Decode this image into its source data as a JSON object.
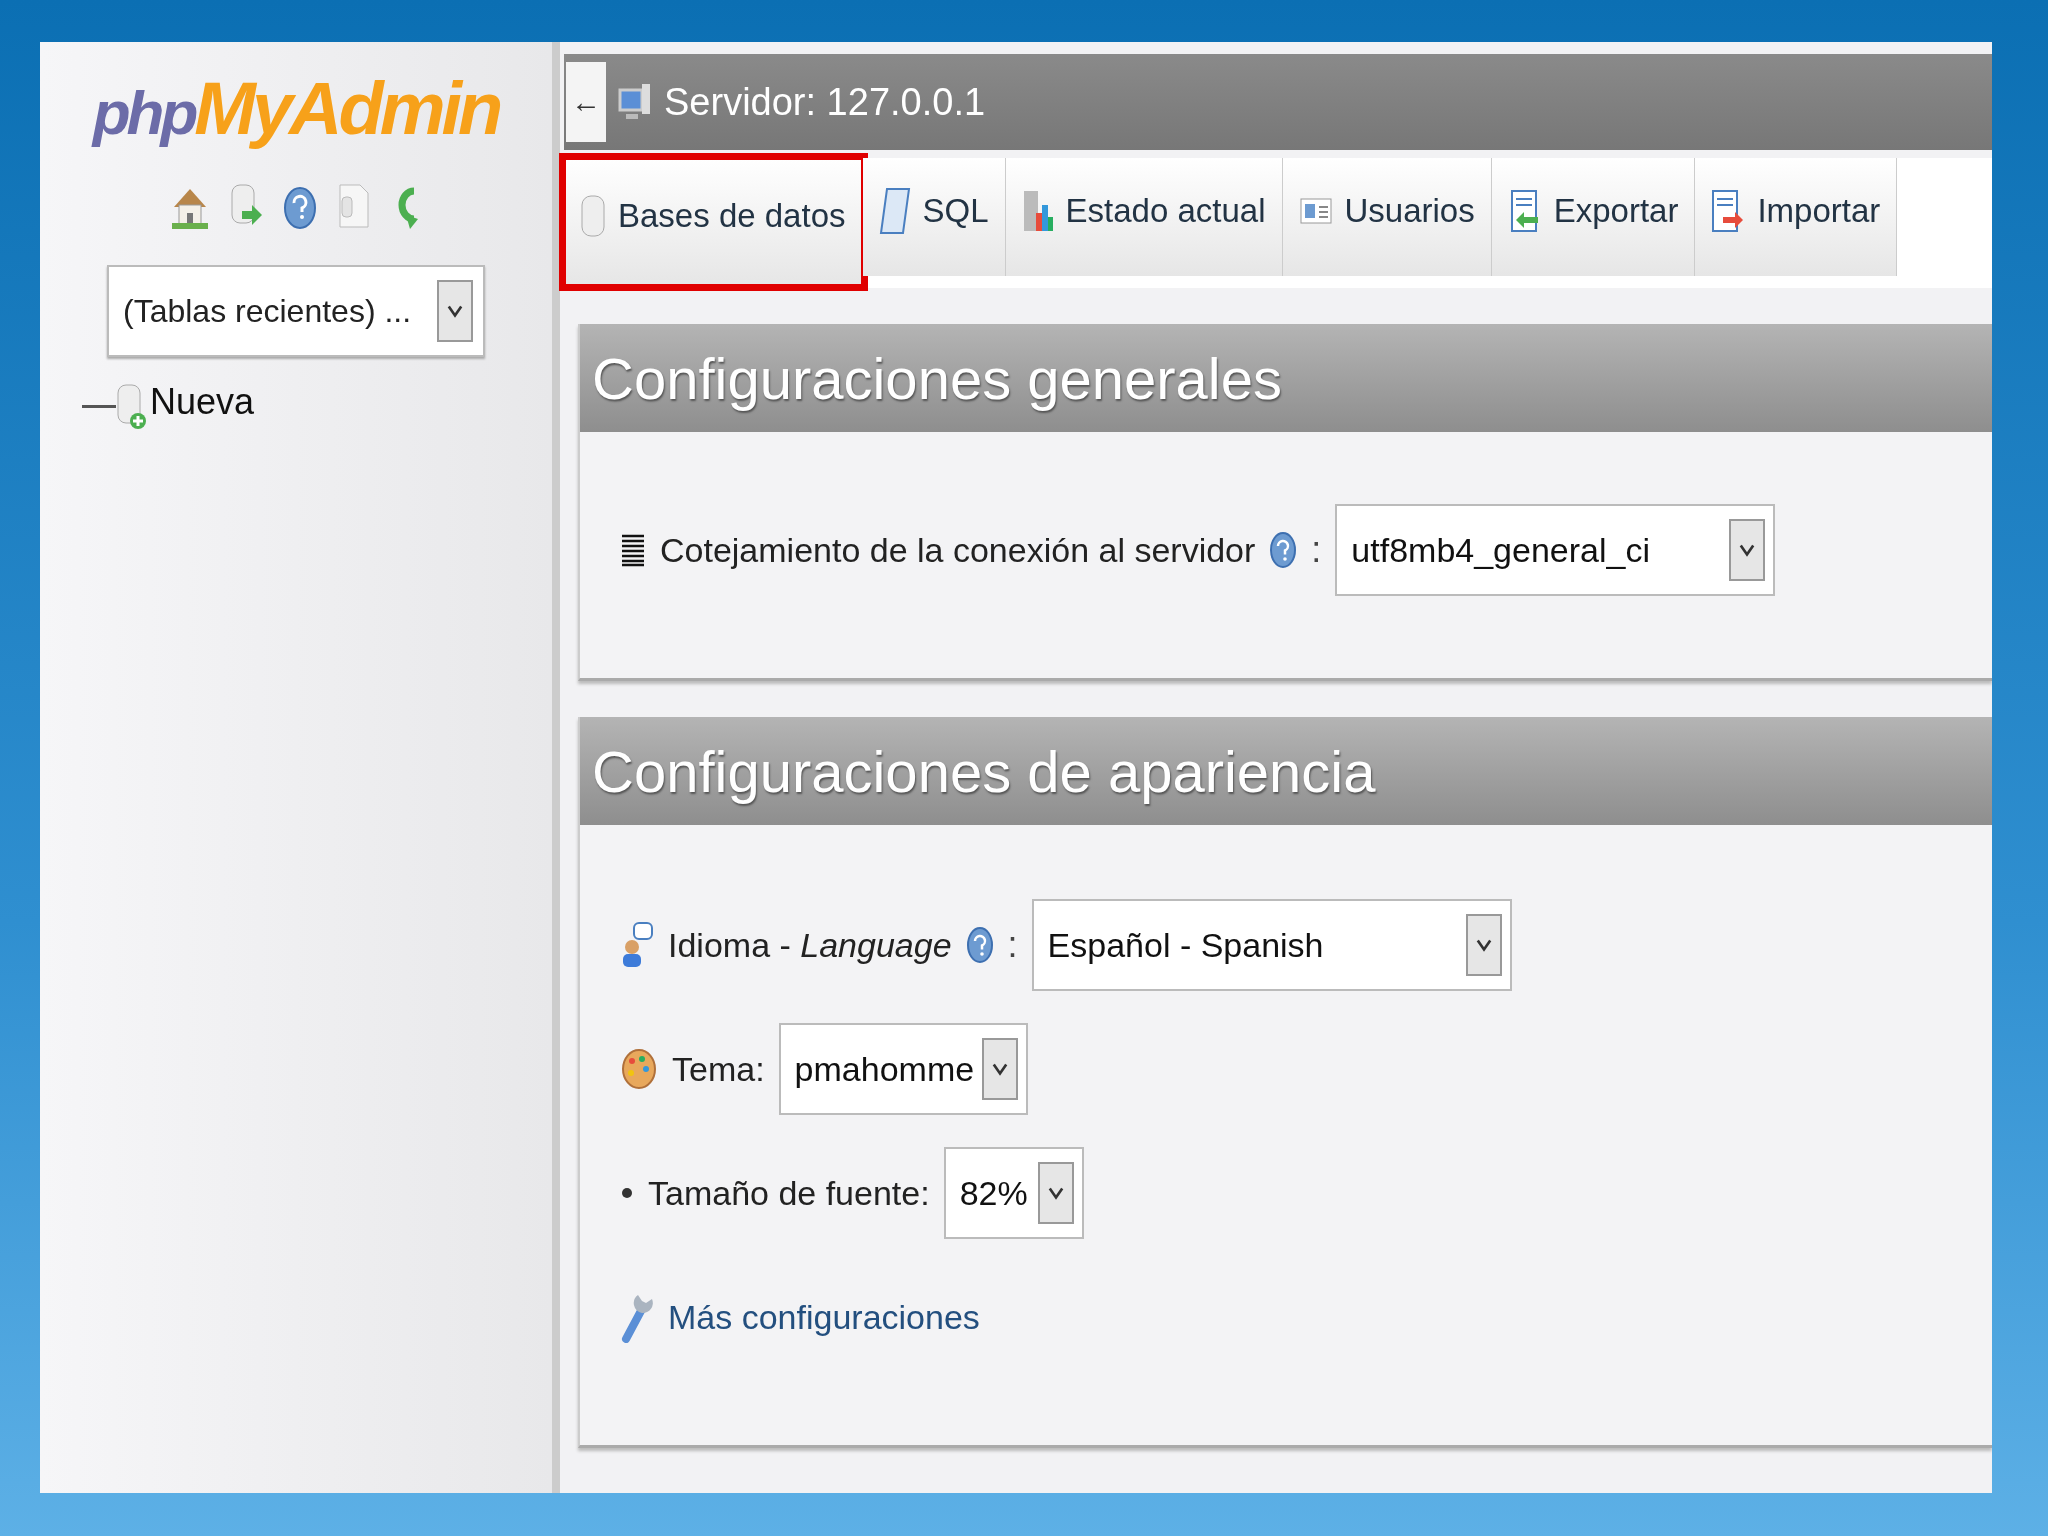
{
  "logo": {
    "part_1": "php",
    "part_2": "MyAdmin"
  },
  "sidebar": {
    "recent_tables": "(Tablas recientes) ...",
    "tree": [
      {
        "label": "Nueva"
      }
    ]
  },
  "breadcrumb": {
    "back": "←",
    "server": "Servidor: 127.0.0.1"
  },
  "tabs": [
    {
      "label": "Bases de datos",
      "highlighted": true
    },
    {
      "label": "SQL",
      "highlighted": false
    },
    {
      "label": "Estado actual",
      "highlighted": false
    },
    {
      "label": "Usuarios",
      "highlighted": false
    },
    {
      "label": "Exportar",
      "highlighted": false
    },
    {
      "label": "Importar",
      "highlighted": false
    }
  ],
  "sections": [
    {
      "title": "Configuraciones generales",
      "rows": [
        {
          "kind": "select",
          "label": "Cotejamiento de la conexión al servidor",
          "help": true,
          "separator": ":",
          "value": "utf8mb4_general_ci"
        }
      ]
    },
    {
      "title": "Configuraciones de apariencia",
      "rows": [
        {
          "kind": "select",
          "label": "Idioma - *Language*",
          "help": true,
          "separator": ":",
          "value": "Español - Spanish"
        },
        {
          "kind": "select",
          "label": "Tema:",
          "help": false,
          "value": "pmahomme"
        },
        {
          "kind": "select",
          "label": "Tamaño de fuente:",
          "help": false,
          "value": "82%"
        },
        {
          "kind": "link",
          "label": "Más configuraciones"
        }
      ]
    }
  ]
}
